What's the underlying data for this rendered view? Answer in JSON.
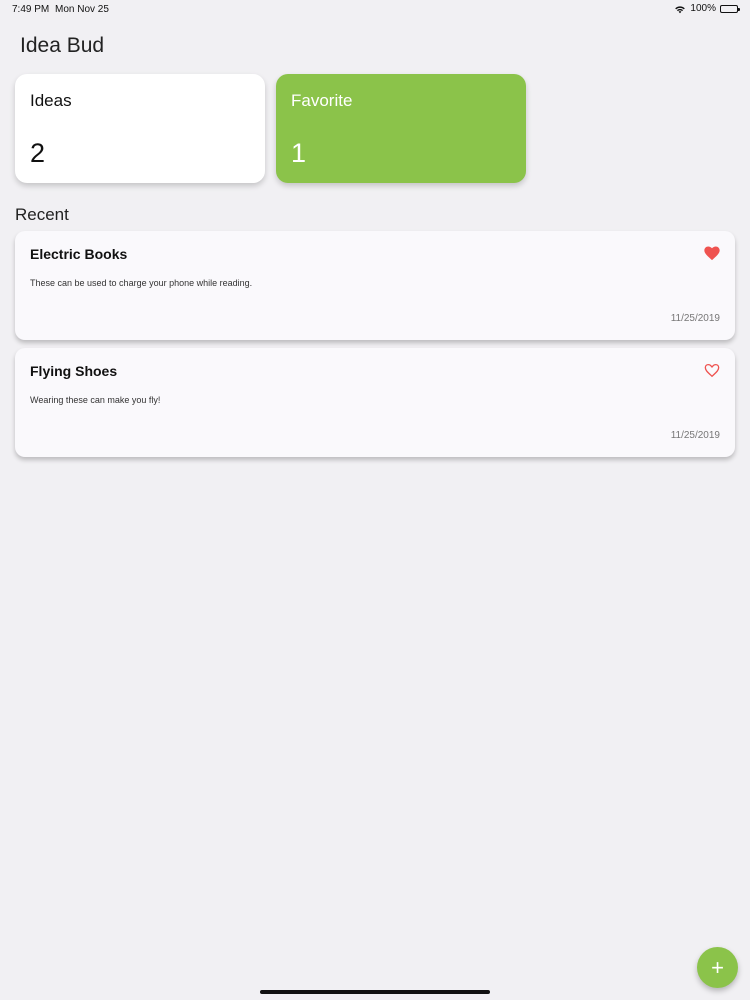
{
  "status": {
    "time": "7:49 PM",
    "date": "Mon Nov 25",
    "battery": "100%"
  },
  "app": {
    "title": "Idea Bud"
  },
  "stats": {
    "ideas_label": "Ideas",
    "ideas_count": "2",
    "favorite_label": "Favorite",
    "favorite_count": "1"
  },
  "recent": {
    "title": "Recent",
    "items": [
      {
        "title": "Electric Books",
        "description": "These can be used to charge your phone while reading.",
        "date": "11/25/2019",
        "favorite": true
      },
      {
        "title": "Flying Shoes",
        "description": "Wearing these can make you fly!",
        "date": "11/25/2019",
        "favorite": false
      }
    ]
  },
  "fab": {
    "label": "+"
  },
  "colors": {
    "accent": "#8bc34a",
    "heart": "#ef5350",
    "background": "#f1f0f3"
  }
}
